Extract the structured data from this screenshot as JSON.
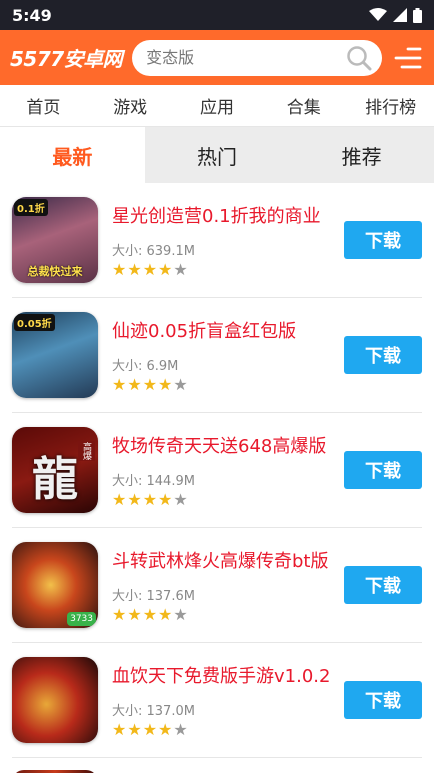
{
  "status_bar": {
    "time": "5:49"
  },
  "header": {
    "logo": "5577安卓网",
    "search_placeholder": "变态版"
  },
  "nav": {
    "items": [
      "首页",
      "游戏",
      "应用",
      "合集",
      "排行榜"
    ]
  },
  "tabs": {
    "items": [
      "最新",
      "热门",
      "推荐"
    ],
    "active": 0
  },
  "size_prefix": "大小: ",
  "download_label": "下载",
  "apps": [
    {
      "title": "星光创造营0.1折我的商业",
      "size": "大小: 639.1M",
      "rating": 4,
      "icon": {
        "badge": "0.1折",
        "bottom_text": "总裁快过来",
        "colors": "linear-gradient(160deg,#3a2a48 0%,#a8627a 45%,#5a3246 100%)"
      }
    },
    {
      "title": "仙迹0.05折盲盒红包版",
      "size": "大小: 6.9M",
      "rating": 4,
      "icon": {
        "badge": "0.05折",
        "colors": "linear-gradient(160deg,#1e3e5a 0%,#4f8fb8 45%,#233a55 100%)"
      }
    },
    {
      "title": "牧场传奇天天送648高爆版",
      "size": "大小: 144.9M",
      "rating": 4,
      "icon": {
        "glyph": "龍",
        "tag": "高爆",
        "colors": "linear-gradient(160deg,#5a0a08 0%,#8a1a12 50%,#2a0504 100%)"
      }
    },
    {
      "title": "斗转武林烽火高爆传奇bt版",
      "size": "大小: 137.6M",
      "rating": 4,
      "icon": {
        "corner": "3733",
        "colors": "radial-gradient(circle at 45% 50%,#f2c04a 0%,#c8461c 40%,#2a1210 100%)"
      }
    },
    {
      "title": "血饮天下免费版手游v1.0.2",
      "size": "大小: 137.0M",
      "rating": 4,
      "icon": {
        "colors": "radial-gradient(circle at 40% 55%,#e8a838 0%,#b82a1a 45%,#1a0808 100%)"
      }
    }
  ],
  "colors": {
    "header_bg": "#ff6a2b",
    "title_red": "#e8192c",
    "download_blue": "#1fa8f0",
    "active_tab": "#ff5a1f"
  }
}
